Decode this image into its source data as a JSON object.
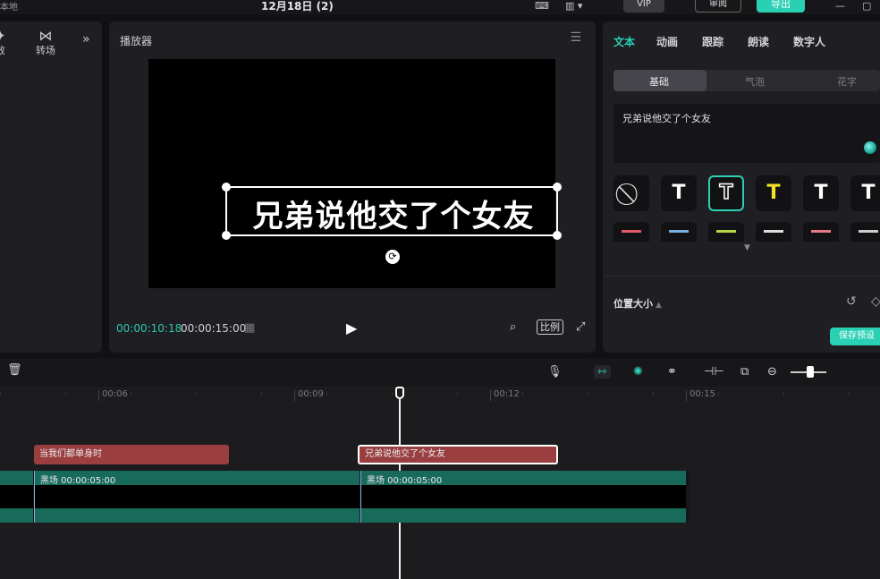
{
  "topbar": {
    "local_label": "本地",
    "title": "12月18日 (2)",
    "vip_label": "VIP",
    "review_label": "审阅",
    "export_label": "导出"
  },
  "left_panel": {
    "tabs": [
      {
        "label": "效",
        "icon": "sparkle-icon"
      },
      {
        "label": "转场",
        "icon": "transition-icon"
      }
    ],
    "more_icon": "double-chevron-right-icon"
  },
  "player": {
    "header": "播放器",
    "caption": "兄弟说他交了个女友",
    "current_time": "00:00:10:18",
    "total_time": "00:00:15:00",
    "ratio_label": "比例"
  },
  "right_panel": {
    "tabs": [
      {
        "label": "文本",
        "active": true
      },
      {
        "label": "动画",
        "active": false
      },
      {
        "label": "跟踪",
        "active": false
      },
      {
        "label": "朗读",
        "active": false
      },
      {
        "label": "数字人",
        "active": false
      }
    ],
    "subtabs": [
      {
        "label": "基础",
        "active": true
      },
      {
        "label": "气泡",
        "active": false
      },
      {
        "label": "花字",
        "active": false
      }
    ],
    "text_value": "兄弟说他交了个女友",
    "presets": [
      {
        "glyph": "⃠",
        "kind": "none"
      },
      {
        "glyph": "T",
        "color": "#ffffff"
      },
      {
        "glyph": "T",
        "color": "#ffffff",
        "selected": true
      },
      {
        "glyph": "T",
        "color": "#f5e12a"
      },
      {
        "glyph": "T",
        "color": "#ffffff"
      },
      {
        "glyph": "T",
        "color": "#ffffff"
      }
    ],
    "preset_row2_colors": [
      "#e05a6a",
      "#7ab0e0",
      "#b8d84a",
      "#dddddd",
      "#e87a8a",
      "#cccccc"
    ],
    "section_label": "位置大小",
    "save_preset_label": "保存预设"
  },
  "timeline": {
    "ruler": [
      {
        "label": "00:06"
      },
      {
        "label": "00:09"
      },
      {
        "label": "00:12"
      },
      {
        "label": "00:15"
      }
    ],
    "text_clips": [
      {
        "label": "当我们都单身时",
        "selected": false
      },
      {
        "label": "兄弟说他交了个女友",
        "selected": true
      }
    ],
    "video_clips": [
      {
        "label": "黑场  00:00:05:00"
      },
      {
        "label": "黑场  00:00:05:00"
      }
    ]
  },
  "colors": {
    "accent": "#2ad0b4",
    "text_clip": "#9a3e40",
    "video_clip": "#186a5a"
  }
}
